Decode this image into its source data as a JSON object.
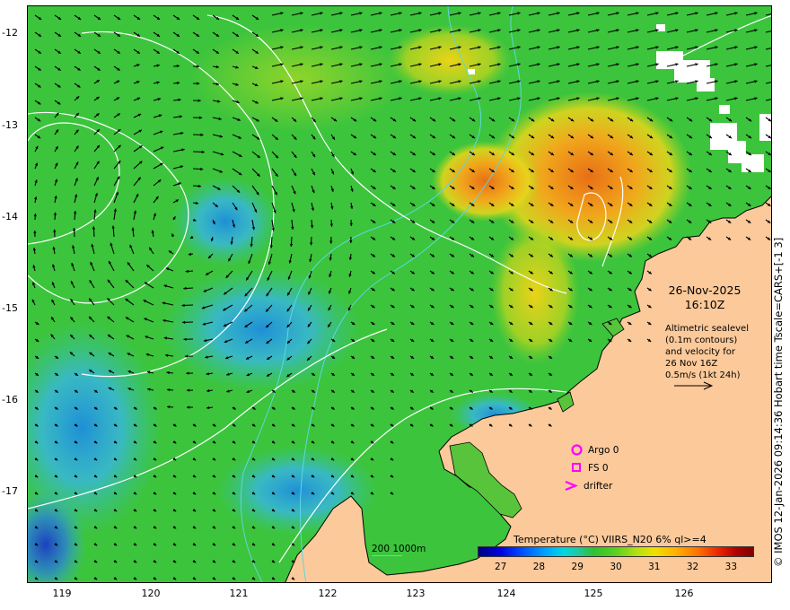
{
  "map": {
    "title_date": "26-Nov-2025",
    "title_time": "16:10Z",
    "velocity_note": "Altimetric sealevel\n(0.1m contours)\nand velocity for\n26 Nov 16Z\n0.5m/s (1kt 24h)",
    "lat_ticks": [
      "-12",
      "-13",
      "-14",
      "-15",
      "-16",
      "-17"
    ],
    "lon_ticks": [
      "119",
      "120",
      "121",
      "122",
      "123",
      "124",
      "125",
      "126"
    ],
    "legend": {
      "argo": "Argo 0",
      "fs": "FS 0",
      "drifter": "drifter"
    },
    "colorbar": {
      "title": "Temperature (°C) VIIRS_N20 6% ql>=4",
      "ticks": [
        "27",
        "28",
        "29",
        "30",
        "31",
        "32",
        "33"
      ],
      "min": 26.4,
      "max": 33.6
    },
    "depth_key": "200  1000m",
    "credit": "© IMOS 12-Jan-2026 09:14:36 Hobart time Tscale=CARS+[-1 3]",
    "colors": {
      "land": "#fbc99a",
      "sea_green": "#38c43c",
      "warm_yellow": "#f0d318",
      "warm_orange": "#eb8a1b",
      "cool_cyan": "#35b7e8",
      "legend_magenta": "#ff00ff",
      "isobath": "#5fd6df"
    }
  }
}
